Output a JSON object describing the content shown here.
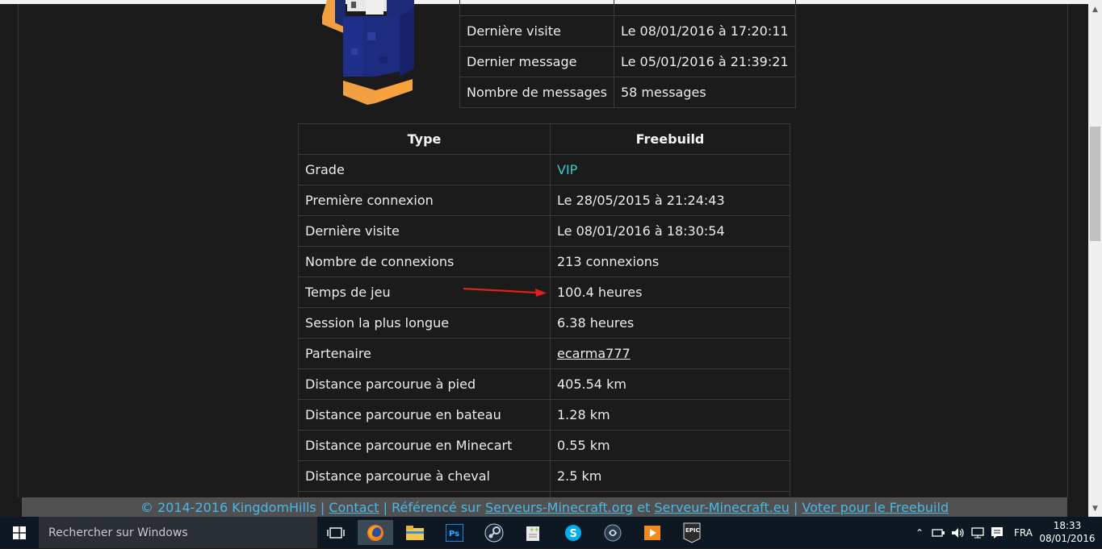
{
  "profile_rows": [
    {
      "label": "Dernière visite",
      "value": "Le 08/01/2016 à 17:20:11"
    },
    {
      "label": "Dernier message",
      "value": "Le 05/01/2016 à 21:39:21"
    },
    {
      "label": "Nombre de messages",
      "value": "58 messages"
    }
  ],
  "stats": {
    "header_type": "Type",
    "header_server": "Freebuild",
    "rows": [
      {
        "label": "Grade",
        "value": "VIP"
      },
      {
        "label": "Première connexion",
        "value": "Le 28/05/2015 à 21:24:43"
      },
      {
        "label": "Dernière visite",
        "value": "Le 08/01/2016 à 18:30:54"
      },
      {
        "label": "Nombre de connexions",
        "value": "213 connexions"
      },
      {
        "label": "Temps de jeu",
        "value": "100.4 heures"
      },
      {
        "label": "Session la plus longue",
        "value": "6.38 heures"
      },
      {
        "label": "Partenaire",
        "value": "ecarma777"
      },
      {
        "label": "Distance parcourue à pied",
        "value": "405.54 km"
      },
      {
        "label": "Distance parcourue en bateau",
        "value": "1.28 km"
      },
      {
        "label": "Distance parcourue en Minecart",
        "value": "0.55 km"
      },
      {
        "label": "Distance parcourue à cheval",
        "value": "2.5 km"
      }
    ]
  },
  "footer": {
    "copyright": "© 2014-2016 KingdomHills",
    "sep": "|",
    "contact": "Contact",
    "referenced": "Référencé sur",
    "link1": "Serveurs-Minecraft.org",
    "and": "et",
    "link2": "Serveur-Minecraft.eu",
    "vote": "Voter pour le Freebuild"
  },
  "taskbar": {
    "search_placeholder": "Rechercher sur Windows",
    "language": "FRA",
    "time": "18:33",
    "date": "08/01/2016",
    "epic_label": "EPIC"
  },
  "colors": {
    "accent_vip": "#33cccc",
    "footer_link": "#49b8e8",
    "arrow": "#e0201c"
  }
}
